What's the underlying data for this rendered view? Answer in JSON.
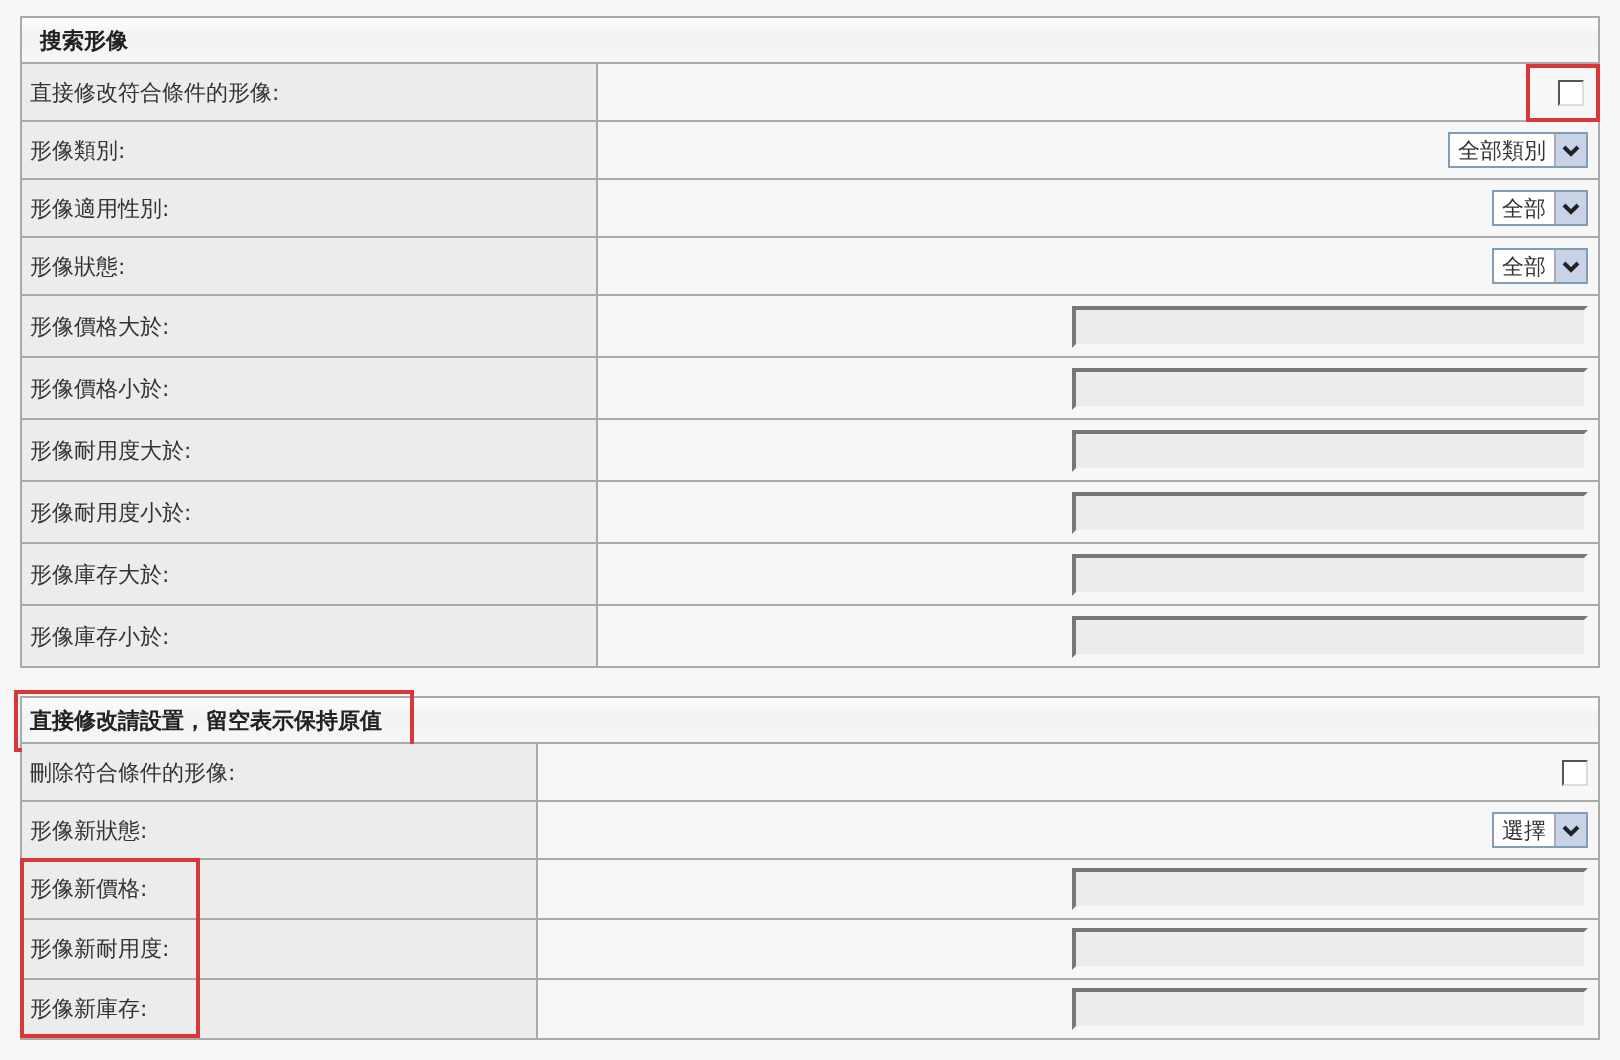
{
  "sections": [
    {
      "title": "搜索形像",
      "highlighted": false,
      "rows": [
        {
          "label": "直接修改符合條件的形像:",
          "highlighted": false,
          "control": {
            "kind": "checkbox",
            "checked": false,
            "highlighted": true
          }
        },
        {
          "label": "形像類別:",
          "highlighted": false,
          "control": {
            "kind": "select",
            "value": "全部類別",
            "highlighted": false
          }
        },
        {
          "label": "形像適用性別:",
          "highlighted": false,
          "control": {
            "kind": "select",
            "value": "全部",
            "highlighted": false
          }
        },
        {
          "label": "形像狀態:",
          "highlighted": false,
          "control": {
            "kind": "select",
            "value": "全部",
            "highlighted": false
          }
        },
        {
          "label": "形像價格大於:",
          "highlighted": false,
          "control": {
            "kind": "text",
            "highlighted": false
          }
        },
        {
          "label": "形像價格小於:",
          "highlighted": false,
          "control": {
            "kind": "text",
            "highlighted": false
          }
        },
        {
          "label": "形像耐用度大於:",
          "highlighted": false,
          "control": {
            "kind": "text",
            "highlighted": false
          }
        },
        {
          "label": "形像耐用度小於:",
          "highlighted": false,
          "control": {
            "kind": "text",
            "highlighted": false
          }
        },
        {
          "label": "形像庫存大於:",
          "highlighted": false,
          "control": {
            "kind": "text",
            "highlighted": false
          }
        },
        {
          "label": "形像庫存小於:",
          "highlighted": false,
          "control": {
            "kind": "text",
            "highlighted": false
          }
        }
      ]
    },
    {
      "title": "直接修改請設置，留空表示保持原值",
      "highlighted": true,
      "rows": [
        {
          "label": "刪除符合條件的形像:",
          "highlighted": false,
          "control": {
            "kind": "checkbox",
            "checked": false,
            "highlighted": false
          }
        },
        {
          "label": "形像新狀態:",
          "highlighted": false,
          "control": {
            "kind": "select",
            "value": "選擇",
            "highlighted": false
          }
        },
        {
          "label": "形像新價格:",
          "highlighted": true,
          "control": {
            "kind": "text",
            "highlighted": false
          }
        },
        {
          "label": "形像新耐用度:",
          "highlighted": true,
          "control": {
            "kind": "text",
            "highlighted": false
          }
        },
        {
          "label": "形像新庫存:",
          "highlighted": true,
          "control": {
            "kind": "text",
            "highlighted": false
          }
        }
      ]
    }
  ]
}
